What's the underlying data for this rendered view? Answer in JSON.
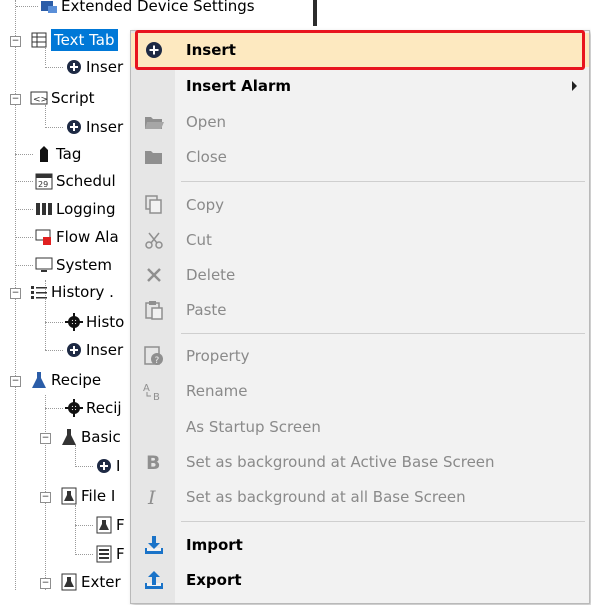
{
  "tree": {
    "items": [
      {
        "label": "Extended Device Settings"
      },
      {
        "label": "Text Tab"
      },
      {
        "label": "Inser"
      },
      {
        "label": "Script"
      },
      {
        "label": "Inser"
      },
      {
        "label": "Tag"
      },
      {
        "label": "Schedul"
      },
      {
        "label": "Logging"
      },
      {
        "label": "Flow Ala"
      },
      {
        "label": "System"
      },
      {
        "label": "History ."
      },
      {
        "label": "Histo"
      },
      {
        "label": "Inser"
      },
      {
        "label": "Recipe"
      },
      {
        "label": "Recij"
      },
      {
        "label": "Basic"
      },
      {
        "label": "I"
      },
      {
        "label": "File I"
      },
      {
        "label": "F"
      },
      {
        "label": "F"
      },
      {
        "label": "Exter"
      }
    ]
  },
  "menu": {
    "items": [
      {
        "label": "Insert",
        "icon": "plus-circle-icon",
        "enabled": true
      },
      {
        "label": "Insert Alarm",
        "icon": "",
        "enabled": true,
        "submenu": true
      },
      {
        "label": "Open",
        "icon": "folder-open-icon",
        "enabled": false
      },
      {
        "label": "Close",
        "icon": "folder-close-icon",
        "enabled": false
      },
      {
        "label": "Copy",
        "icon": "copy-icon",
        "enabled": false
      },
      {
        "label": "Cut",
        "icon": "scissors-icon",
        "enabled": false
      },
      {
        "label": "Delete",
        "icon": "x-icon",
        "enabled": false
      },
      {
        "label": "Paste",
        "icon": "paste-icon",
        "enabled": false
      },
      {
        "label": "Property",
        "icon": "property-icon",
        "enabled": false
      },
      {
        "label": "Rename",
        "icon": "rename-icon",
        "enabled": false
      },
      {
        "label": "As Startup Screen",
        "icon": "",
        "enabled": false
      },
      {
        "label": "Set as background at Active Base Screen",
        "icon": "bold-b-icon",
        "enabled": false
      },
      {
        "label": "Set as background at all Base Screen",
        "icon": "italic-i-icon",
        "enabled": false
      },
      {
        "label": "Import",
        "icon": "import-icon",
        "enabled": true
      },
      {
        "label": "Export",
        "icon": "export-icon",
        "enabled": true
      }
    ]
  },
  "colors": {
    "highlight": "#fde9c0",
    "annotation_box": "#e8141e",
    "selection": "#0078d7",
    "import_export_blue": "#1a73c8"
  }
}
